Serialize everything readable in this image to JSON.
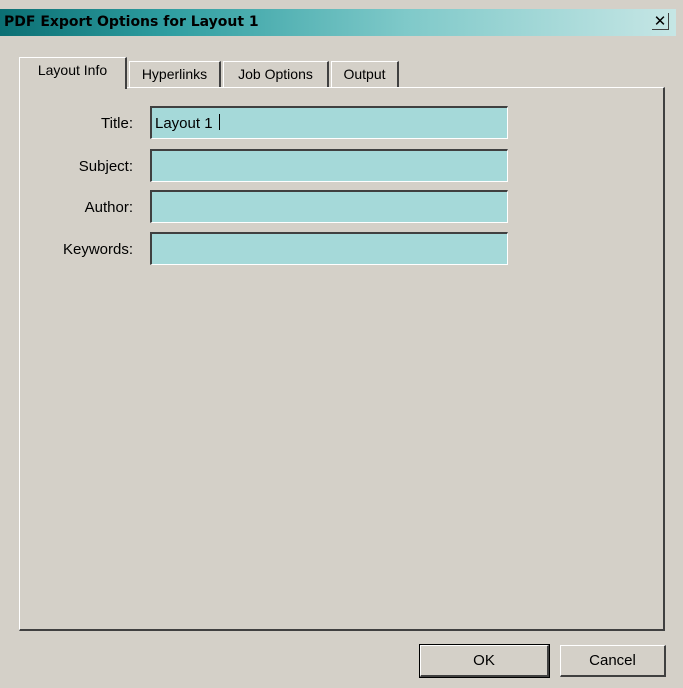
{
  "window": {
    "title": "PDF Export Options for Layout 1",
    "close_glyph": "✕",
    "colors": {
      "face": "#d4d0c8",
      "title_bar_start": "#0b6f73",
      "title_bar_end": "#c6e6e5",
      "input_bg": "#a5d9d9"
    }
  },
  "tabs": [
    {
      "label": "Layout Info",
      "active": true
    },
    {
      "label": "Hyperlinks",
      "active": false
    },
    {
      "label": "Job Options",
      "active": false
    },
    {
      "label": "Output",
      "active": false
    }
  ],
  "form": {
    "title": {
      "label": "Title:",
      "value": "Layout 1"
    },
    "subject": {
      "label": "Subject:",
      "value": ""
    },
    "author": {
      "label": "Author:",
      "value": ""
    },
    "keywords": {
      "label": "Keywords:",
      "value": ""
    }
  },
  "buttons": {
    "ok": "OK",
    "cancel": "Cancel"
  }
}
